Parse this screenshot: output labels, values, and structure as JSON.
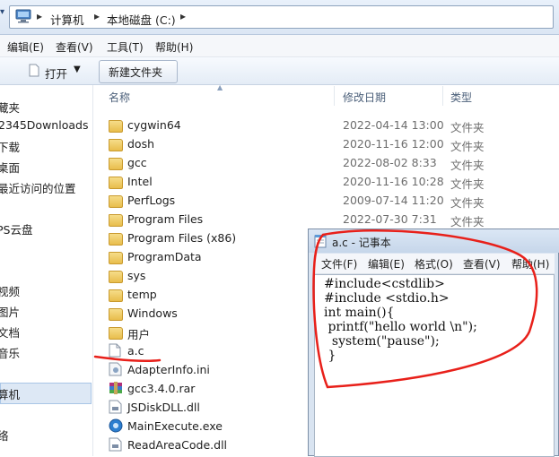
{
  "address": {
    "crumbs": [
      "计算机",
      "本地磁盘 (C:)"
    ],
    "separator": "▸"
  },
  "menubar": {
    "items": [
      "编辑(E)",
      "查看(V)",
      "工具(T)",
      "帮助(H)"
    ]
  },
  "toolbar": {
    "open_label": "打开",
    "new_folder_label": "新建文件夹"
  },
  "navpane": {
    "items": [
      "藏夹",
      "2345Downloads",
      "下载",
      "桌面",
      "最近访问的位置",
      "PS云盘",
      "视频",
      "图片",
      "文档",
      "音乐",
      "算机",
      "络"
    ]
  },
  "columns": {
    "name": "名称",
    "date": "修改日期",
    "type": "类型"
  },
  "files": [
    {
      "name": "cygwin64",
      "date": "2022-04-14 13:00",
      "type": "文件夹",
      "icon": "folder-icon"
    },
    {
      "name": "dosh",
      "date": "2020-11-16 12:00",
      "type": "文件夹",
      "icon": "folder-icon"
    },
    {
      "name": "gcc",
      "date": "2022-08-02 8:33",
      "type": "文件夹",
      "icon": "folder-icon"
    },
    {
      "name": "Intel",
      "date": "2020-11-16 10:28",
      "type": "文件夹",
      "icon": "folder-icon"
    },
    {
      "name": "PerfLogs",
      "date": "2009-07-14 11:20",
      "type": "文件夹",
      "icon": "folder-icon"
    },
    {
      "name": "Program Files",
      "date": "2022-07-30 7:31",
      "type": "文件夹",
      "icon": "folder-icon"
    },
    {
      "name": "Program Files (x86)",
      "date": "",
      "type": "",
      "icon": "folder-icon"
    },
    {
      "name": "ProgramData",
      "date": "",
      "type": "",
      "icon": "folder-icon"
    },
    {
      "name": "sys",
      "date": "",
      "type": "",
      "icon": "folder-icon"
    },
    {
      "name": "temp",
      "date": "",
      "type": "",
      "icon": "folder-icon"
    },
    {
      "name": "Windows",
      "date": "",
      "type": "",
      "icon": "folder-icon"
    },
    {
      "name": "用户",
      "date": "",
      "type": "",
      "icon": "folder-icon"
    },
    {
      "name": "a.c",
      "date": "",
      "type": "",
      "icon": "text-file-icon"
    },
    {
      "name": "AdapterInfo.ini",
      "date": "",
      "type": "",
      "icon": "ini-file-icon"
    },
    {
      "name": "gcc3.4.0.rar",
      "date": "",
      "type": "",
      "icon": "rar-archive-icon"
    },
    {
      "name": "JSDiskDLL.dll",
      "date": "",
      "type": "",
      "icon": "dll-file-icon"
    },
    {
      "name": "MainExecute.exe",
      "date": "",
      "type": "",
      "icon": "exe-file-icon"
    },
    {
      "name": "ReadAreaCode.dll",
      "date": "",
      "type": "",
      "icon": "dll-file-icon"
    }
  ],
  "notepad": {
    "title": "a.c - 记事本",
    "menu": [
      "文件(F)",
      "编辑(E)",
      "格式(O)",
      "查看(V)",
      "帮助(H)"
    ],
    "code_lines": [
      "#include<cstdlib>",
      "#include <stdio.h>",
      "int main(){",
      " printf(\"hello world \\n\");",
      "  system(\"pause\");",
      " }"
    ]
  },
  "colors": {
    "annotation": "#e8201a",
    "accent": "#3b6ea5",
    "folder": "#e8bd4c"
  }
}
